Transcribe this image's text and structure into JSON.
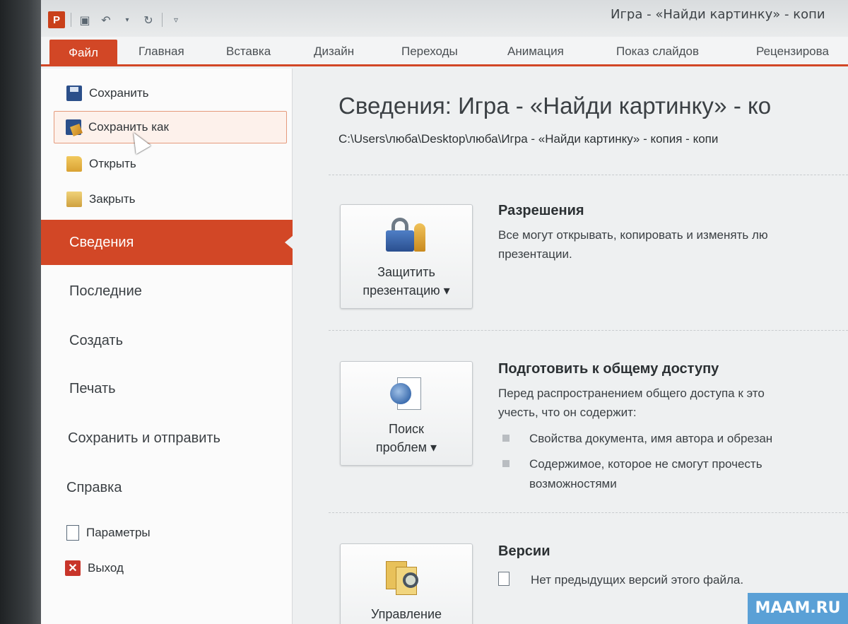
{
  "window": {
    "title": "Игра - «Найди картинку» - копи"
  },
  "ribbon": {
    "tabs": [
      {
        "label": "Файл"
      },
      {
        "label": "Главная"
      },
      {
        "label": "Вставка"
      },
      {
        "label": "Дизайн"
      },
      {
        "label": "Переходы"
      },
      {
        "label": "Анимация"
      },
      {
        "label": "Показ слайдов"
      },
      {
        "label": "Рецензирова"
      }
    ]
  },
  "backstage": {
    "commands": [
      {
        "label": "Сохранить",
        "icon": "save-icon"
      },
      {
        "label": "Сохранить как",
        "icon": "save-as-icon"
      },
      {
        "label": "Открыть",
        "icon": "open-folder-icon"
      },
      {
        "label": "Закрыть",
        "icon": "close-folder-icon"
      }
    ],
    "sections": [
      {
        "label": "Сведения"
      },
      {
        "label": "Последние"
      },
      {
        "label": "Создать"
      },
      {
        "label": "Печать"
      },
      {
        "label": "Сохранить и отправить"
      },
      {
        "label": "Справка"
      }
    ],
    "footer": [
      {
        "label": "Параметры",
        "icon": "options-icon"
      },
      {
        "label": "Выход",
        "icon": "exit-icon"
      }
    ]
  },
  "info": {
    "title": "Сведения: Игра - «Найди картинку» - ко",
    "path": "C:\\Users\\люба\\Desktop\\люба\\Игра - «Найди картинку» - копия - копи",
    "permissions": {
      "button_line1": "Защитить",
      "button_line2": "презентацию ▾",
      "title": "Разрешения",
      "text1": "Все могут открывать, копировать и изменять лю",
      "text2": "презентации."
    },
    "prepare": {
      "button_line1": "Поиск",
      "button_line2": "проблем ▾",
      "title": "Подготовить к общему доступу",
      "text1": "Перед распространением общего доступа к это",
      "text2": "учесть, что он содержит:",
      "bullet1": "Свойства документа, имя автора и обрезан",
      "bullet2a": "Содержимое, которое не смогут прочесть",
      "bullet2b": "возможностями"
    },
    "versions": {
      "button_line1": "Управление",
      "title": "Версии",
      "text1": "Нет предыдущих версий этого файла."
    }
  },
  "watermark": "MAAM.RU",
  "colors": {
    "accent": "#d24726",
    "background": "#eef0f1"
  }
}
